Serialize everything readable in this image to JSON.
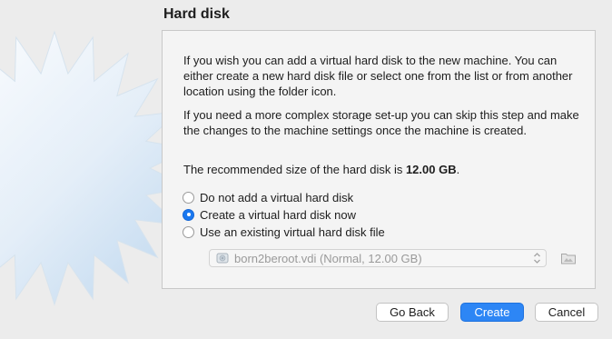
{
  "window": {
    "title": "Hard disk"
  },
  "intro": {
    "paragraph1": "If you wish you can add a virtual hard disk to the new machine. You can either create a new hard disk file or select one from the list or from another location using the folder icon.",
    "paragraph2": "If you need a more complex storage set-up you can skip this step and make the changes to the machine settings once the machine is created.",
    "recommended_prefix": "The recommended size of the hard disk is ",
    "recommended_size": "12.00 GB",
    "recommended_suffix": "."
  },
  "options": [
    {
      "label": "Do not add a virtual hard disk",
      "selected": false
    },
    {
      "label": "Create a virtual hard disk now",
      "selected": true
    },
    {
      "label": "Use an existing virtual hard disk file",
      "selected": false
    }
  ],
  "disk_select": {
    "value": "born2beroot.vdi (Normal, 12.00 GB)",
    "icon": "hard-disk-icon",
    "enabled": false
  },
  "folder_button": {
    "icon": "folder-icon"
  },
  "buttons": {
    "back": "Go Back",
    "create": "Create",
    "cancel": "Cancel"
  },
  "colors": {
    "accent": "#2d86f5",
    "panel": "#f4f4f4",
    "background": "#ececec"
  }
}
